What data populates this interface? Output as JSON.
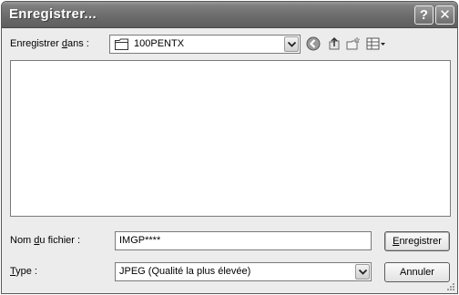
{
  "dialog": {
    "title": "Enregistrer..."
  },
  "top_bar": {
    "save_in_label_prefix": "Enregistrer ",
    "save_in_label_underlined": "d",
    "save_in_label_suffix": "ans :",
    "folder_value": "100PENTX"
  },
  "toolbar": {
    "icons": [
      "back-icon",
      "up-folder-icon",
      "new-folder-icon",
      "view-menu-icon"
    ]
  },
  "filename": {
    "label_prefix": "Nom ",
    "label_underlined": "d",
    "label_suffix": "u fichier :",
    "value": "IMGP****"
  },
  "type": {
    "label_underlined": "T",
    "label_suffix": "ype :",
    "value": "JPEG (Qualité la plus élevée)"
  },
  "buttons": {
    "save_underlined": "E",
    "save_suffix": "nregistrer",
    "cancel": "Annuler"
  }
}
